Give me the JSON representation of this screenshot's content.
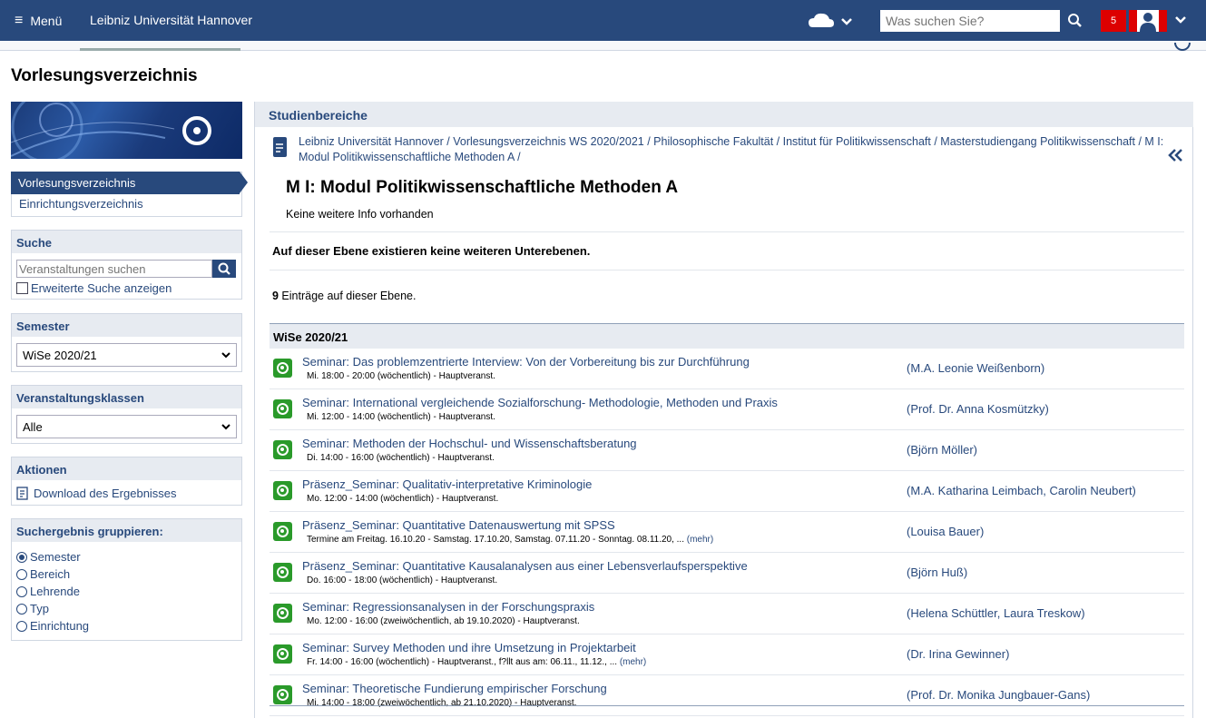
{
  "topbar": {
    "menu_label": "Menü",
    "brand": "Leibniz Universität Hannover",
    "search_placeholder": "Was suchen Sie?",
    "notifications": "5"
  },
  "page_title": "Vorlesungsverzeichnis",
  "sidebar": {
    "nav": [
      {
        "label": "Vorlesungsverzeichnis",
        "active": true
      },
      {
        "label": "Einrichtungsverzeichnis",
        "active": false
      }
    ],
    "search": {
      "title": "Suche",
      "placeholder": "Veranstaltungen suchen",
      "advanced_label": "Erweiterte Suche anzeigen"
    },
    "semester": {
      "title": "Semester",
      "selected": "WiSe 2020/21"
    },
    "klassen": {
      "title": "Veranstaltungsklassen",
      "selected": "Alle"
    },
    "aktionen": {
      "title": "Aktionen",
      "download": "Download des Ergebnisses"
    },
    "gruppieren": {
      "title": "Suchergebnis gruppieren:",
      "options": [
        "Semester",
        "Bereich",
        "Lehrende",
        "Typ",
        "Einrichtung"
      ],
      "selected": "Semester"
    }
  },
  "main": {
    "header": "Studienbereiche",
    "breadcrumb": "Leibniz Universität Hannover / Vorlesungsverzeichnis WS 2020/2021 / Philosophische Fakultät / Institut für Politikwissenschaft / Masterstudiengang Politikwissenschaft / M I: Modul Politikwissenschaftliche Methoden A /",
    "title": "M I: Modul Politikwissenschaftliche Methoden A",
    "info": "Keine weitere Info vorhanden",
    "no_sublevels": "Auf dieser Ebene existieren keine weiteren Unterebenen.",
    "count_number": "9",
    "count_text": " Einträge auf dieser Ebene.",
    "semester_header": "WiSe 2020/21",
    "courses": [
      {
        "title": "Seminar: Das problemzentrierte Interview: Von der Vorbereitung bis zur Durchführung",
        "time": "Mi. 18:00 - 20:00 (wöchentlich) - Hauptveranst.",
        "more": "",
        "lecturer": "(M.A. Leonie Weißenborn)"
      },
      {
        "title": "Seminar: International vergleichende Sozialforschung- Methodologie, Methoden und Praxis",
        "time": "Mi. 12:00 - 14:00 (wöchentlich) - Hauptveranst.",
        "more": "",
        "lecturer": "(Prof. Dr. Anna Kosmützky)"
      },
      {
        "title": "Seminar: Methoden der Hochschul- und Wissenschaftsberatung",
        "time": "Di. 14:00 - 16:00 (wöchentlich) - Hauptveranst.",
        "more": "",
        "lecturer": "(Björn Möller)"
      },
      {
        "title": "Präsenz_Seminar: Qualitativ-interpretative Kriminologie",
        "time": "Mo. 12:00 - 14:00 (wöchentlich) - Hauptveranst.",
        "more": "",
        "lecturer": "(M.A. Katharina Leimbach, Carolin Neubert)"
      },
      {
        "title": "Präsenz_Seminar: Quantitative Datenauswertung mit SPSS",
        "time": "Termine am Freitag. 16.10.20 - Samstag. 17.10.20, Samstag. 07.11.20 - Sonntag. 08.11.20, ... ",
        "more": "(mehr)",
        "lecturer": "(Louisa Bauer)"
      },
      {
        "title": "Präsenz_Seminar: Quantitative Kausalanalysen aus einer Lebensverlaufsperspektive",
        "time": "Do. 16:00 - 18:00 (wöchentlich) - Hauptveranst.",
        "more": "",
        "lecturer": "(Björn Huß)"
      },
      {
        "title": "Seminar: Regressionsanalysen in der Forschungspraxis",
        "time": "Mo. 12:00 - 16:00 (zweiwöchentlich, ab 19.10.2020) - Hauptveranst.",
        "more": "",
        "lecturer": "(Helena Schüttler, Laura Treskow)"
      },
      {
        "title": "Seminar: Survey Methoden und ihre Umsetzung in Projektarbeit",
        "time": "Fr. 14:00 - 16:00 (wöchentlich) - Hauptveranst., f?llt aus am: 06.11., 11.12., ... ",
        "more": "(mehr)",
        "lecturer": "(Dr. Irina Gewinner)"
      },
      {
        "title": "Seminar: Theoretische Fundierung empirischer Forschung",
        "time": "Mi. 14:00 - 18:00 (zweiwöchentlich, ab 21.10.2020) - Hauptveranst.",
        "more": "",
        "lecturer": "(Prof. Dr. Monika Jungbauer-Gans)"
      }
    ]
  },
  "colors": {
    "brand": "#28497c",
    "badge": "#dd0000",
    "course_icon": "#2a9a2a",
    "panel_header": "#e7ebf1"
  }
}
